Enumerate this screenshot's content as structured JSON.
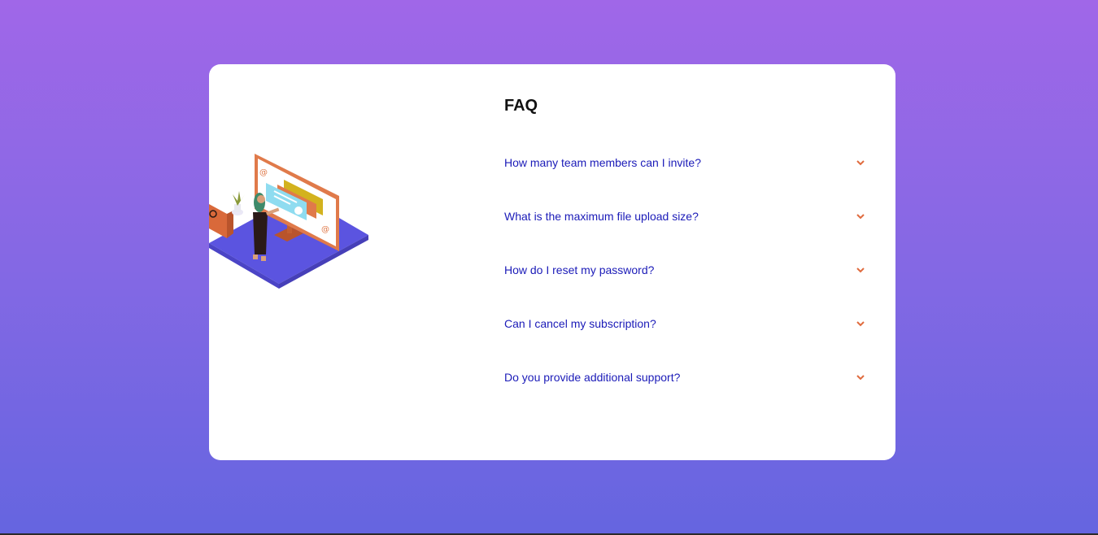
{
  "faq": {
    "title": "FAQ",
    "questions": [
      "How many team members can I invite?",
      "What is the maximum file upload size?",
      "How do I reset my password?",
      "Can I cancel my subscription?",
      "Do you provide additional support?"
    ]
  },
  "colors": {
    "question_text": "#1b1bb8",
    "chevron": "#e06b3e",
    "card_background": "#ffffff"
  },
  "icons": {
    "expand": "chevron-down-icon"
  }
}
